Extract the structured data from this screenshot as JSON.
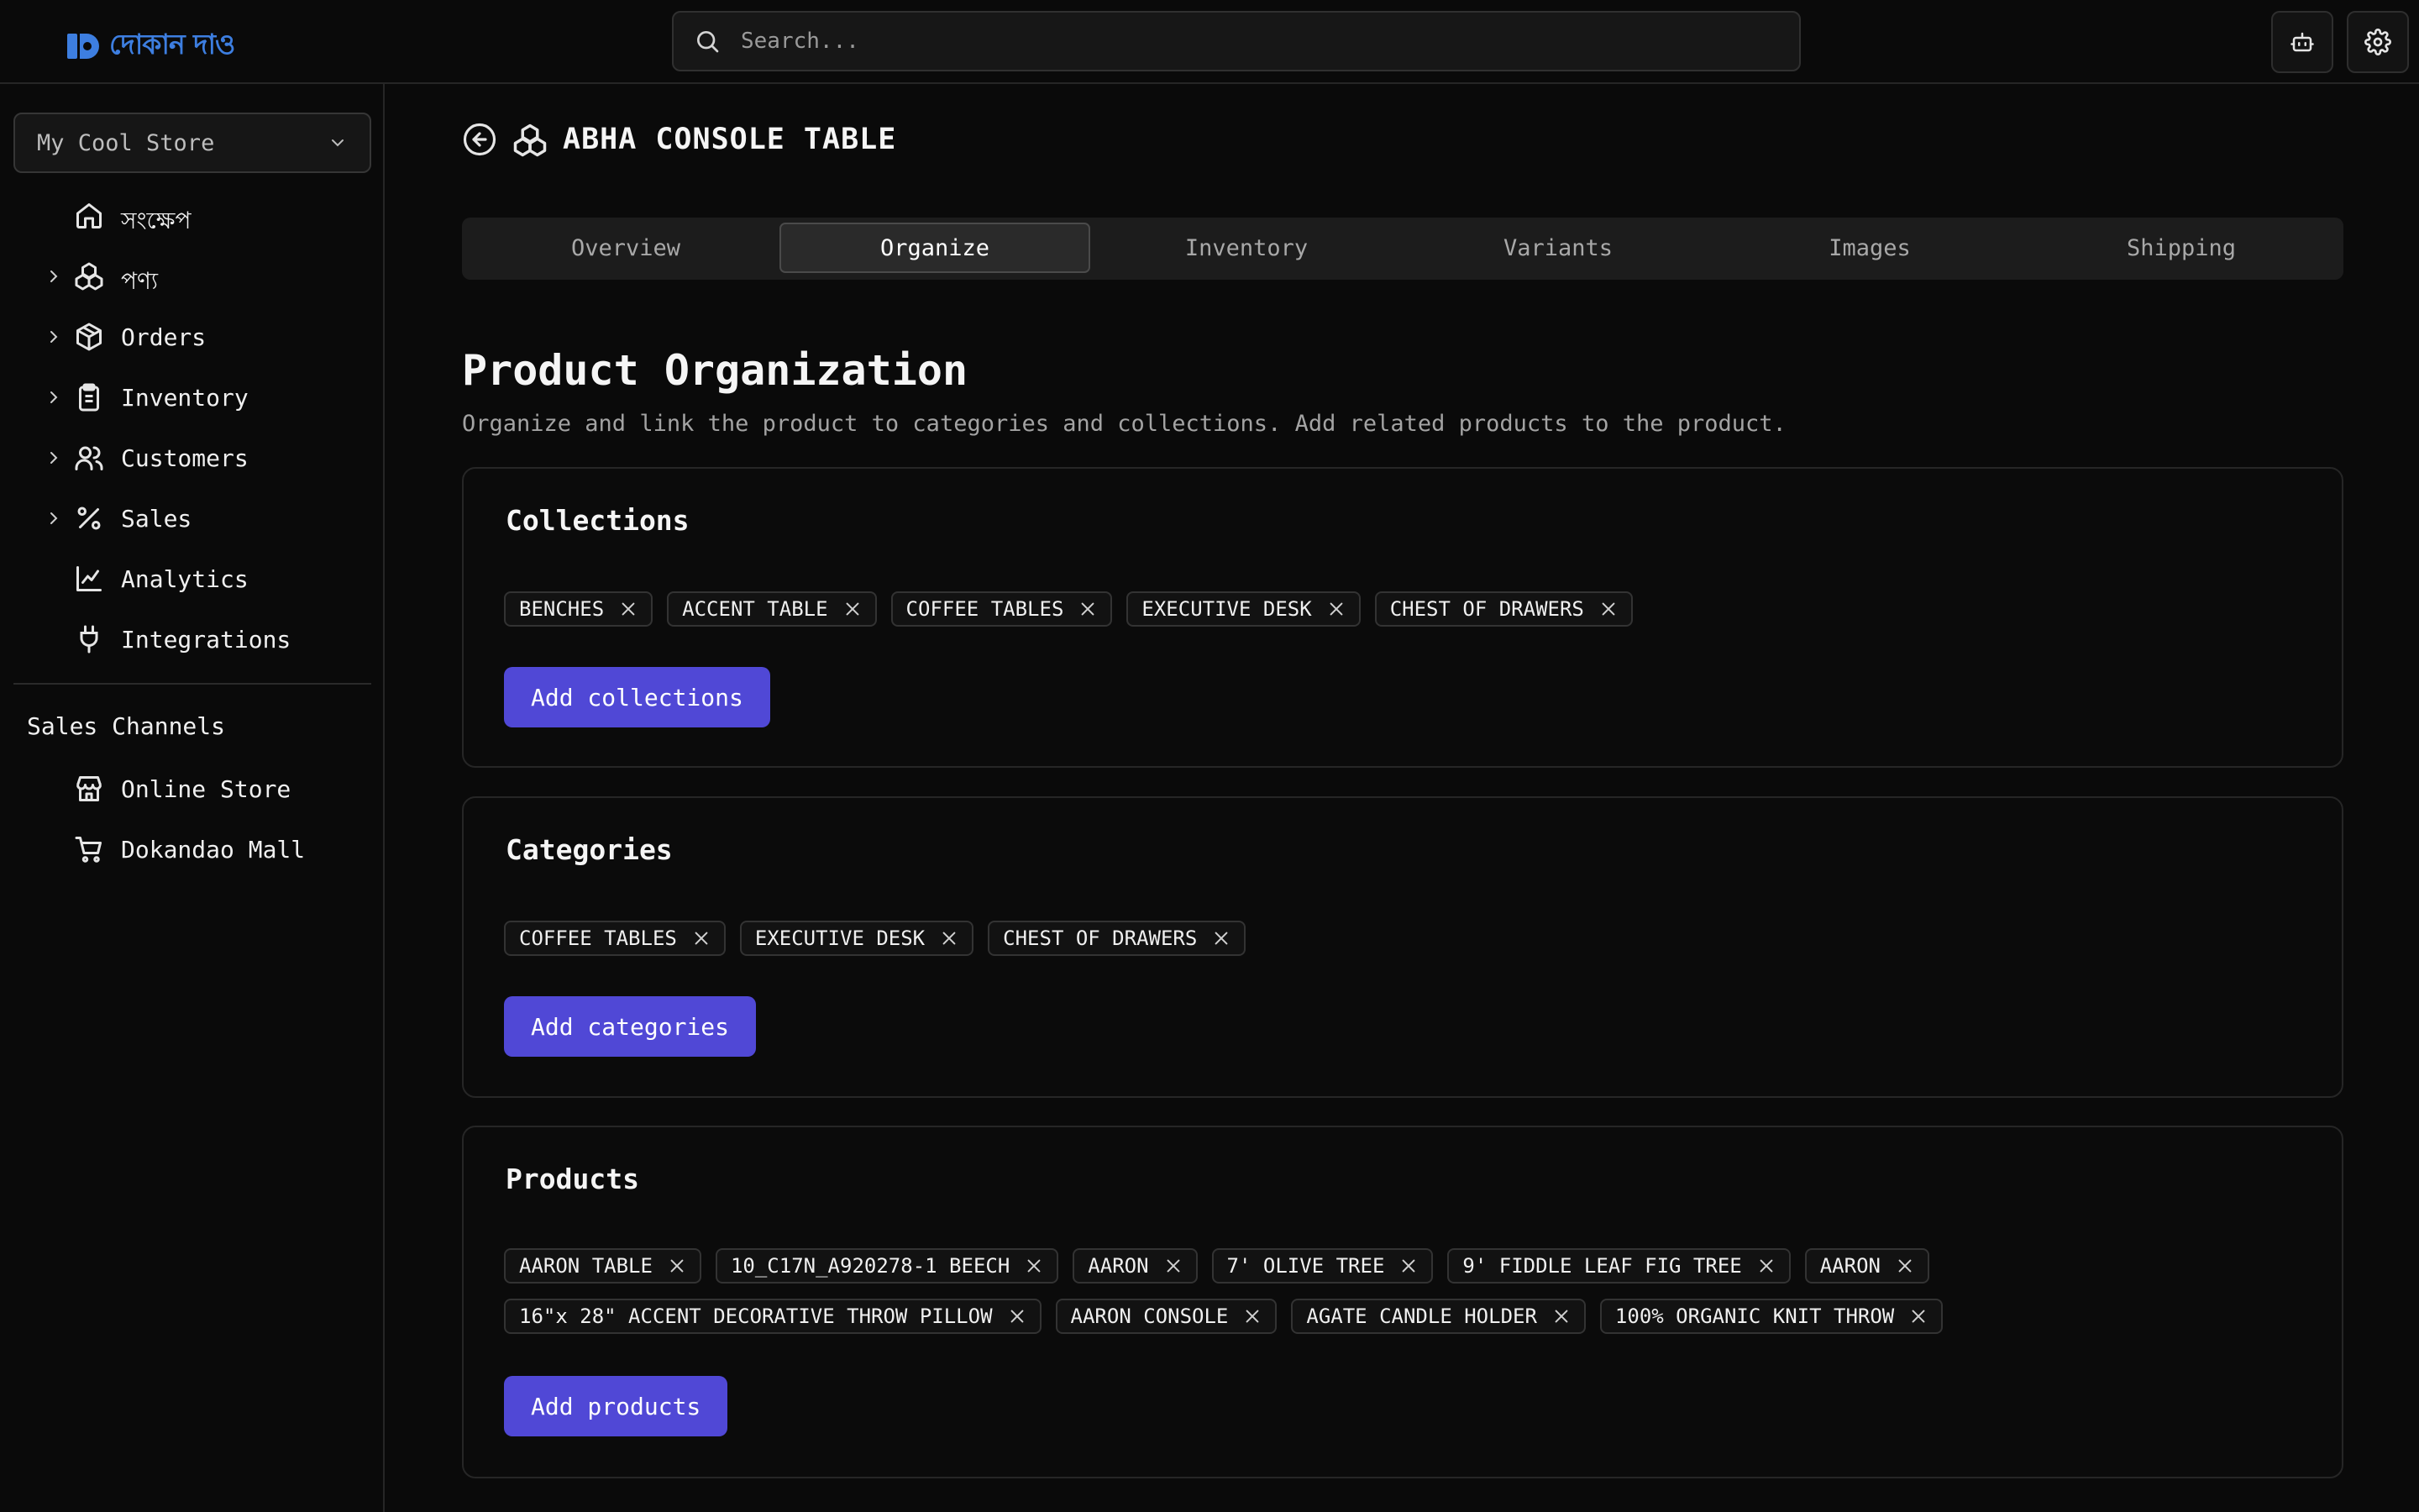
{
  "brand": {
    "name": "দোকান দাও",
    "color": "#3d7ee0"
  },
  "search": {
    "placeholder": "Search..."
  },
  "header_actions": [
    {
      "icon": "robot-icon"
    },
    {
      "icon": "gear-icon"
    }
  ],
  "sidebar": {
    "store_selector": "My Cool Store",
    "items": [
      {
        "label": "সংক্ষেপ",
        "icon": "home-icon",
        "expandable": false
      },
      {
        "label": "পণ্য",
        "icon": "boxes-icon",
        "expandable": true
      },
      {
        "label": "Orders",
        "icon": "package-icon",
        "expandable": true
      },
      {
        "label": "Inventory",
        "icon": "clipboard-icon",
        "expandable": true
      },
      {
        "label": "Customers",
        "icon": "users-icon",
        "expandable": true
      },
      {
        "label": "Sales",
        "icon": "percent-icon",
        "expandable": true
      },
      {
        "label": "Analytics",
        "icon": "chart-icon",
        "expandable": false
      },
      {
        "label": "Integrations",
        "icon": "plug-icon",
        "expandable": false
      }
    ],
    "sales_channels_title": "Sales Channels",
    "channels": [
      {
        "label": "Online Store",
        "icon": "store-icon"
      },
      {
        "label": "Dokandao Mall",
        "icon": "cart-icon"
      }
    ]
  },
  "page": {
    "title": "ABHA CONSOLE TABLE",
    "tabs": [
      "Overview",
      "Organize",
      "Inventory",
      "Variants",
      "Images",
      "Shipping"
    ],
    "active_tab": "Organize",
    "heading": "Product Organization",
    "subtitle": "Organize and link the product to categories and collections. Add related products to the product."
  },
  "collections": {
    "title": "Collections",
    "chips": [
      "BENCHES",
      "ACCENT TABLE",
      "COFFEE TABLES",
      "EXECUTIVE DESK",
      "CHEST OF DRAWERS"
    ],
    "button": "Add collections"
  },
  "categories": {
    "title": "Categories",
    "chips": [
      "COFFEE TABLES",
      "EXECUTIVE DESK",
      "CHEST OF DRAWERS"
    ],
    "button": "Add categories"
  },
  "products": {
    "title": "Products",
    "chips": [
      "AARON TABLE",
      "10_C17N_A920278-1 BEECH",
      "AARON",
      "7' OLIVE TREE",
      "9' FIDDLE LEAF FIG TREE",
      "AARON",
      "16\"x 28\" ACCENT DECORATIVE THROW PILLOW",
      "AARON CONSOLE",
      "AGATE CANDLE HOLDER",
      "100% ORGANIC KNIT THROW"
    ],
    "button": "Add products"
  },
  "colors": {
    "accent": "#5048d6",
    "background": "#0a0a0a",
    "border": "#262626"
  }
}
